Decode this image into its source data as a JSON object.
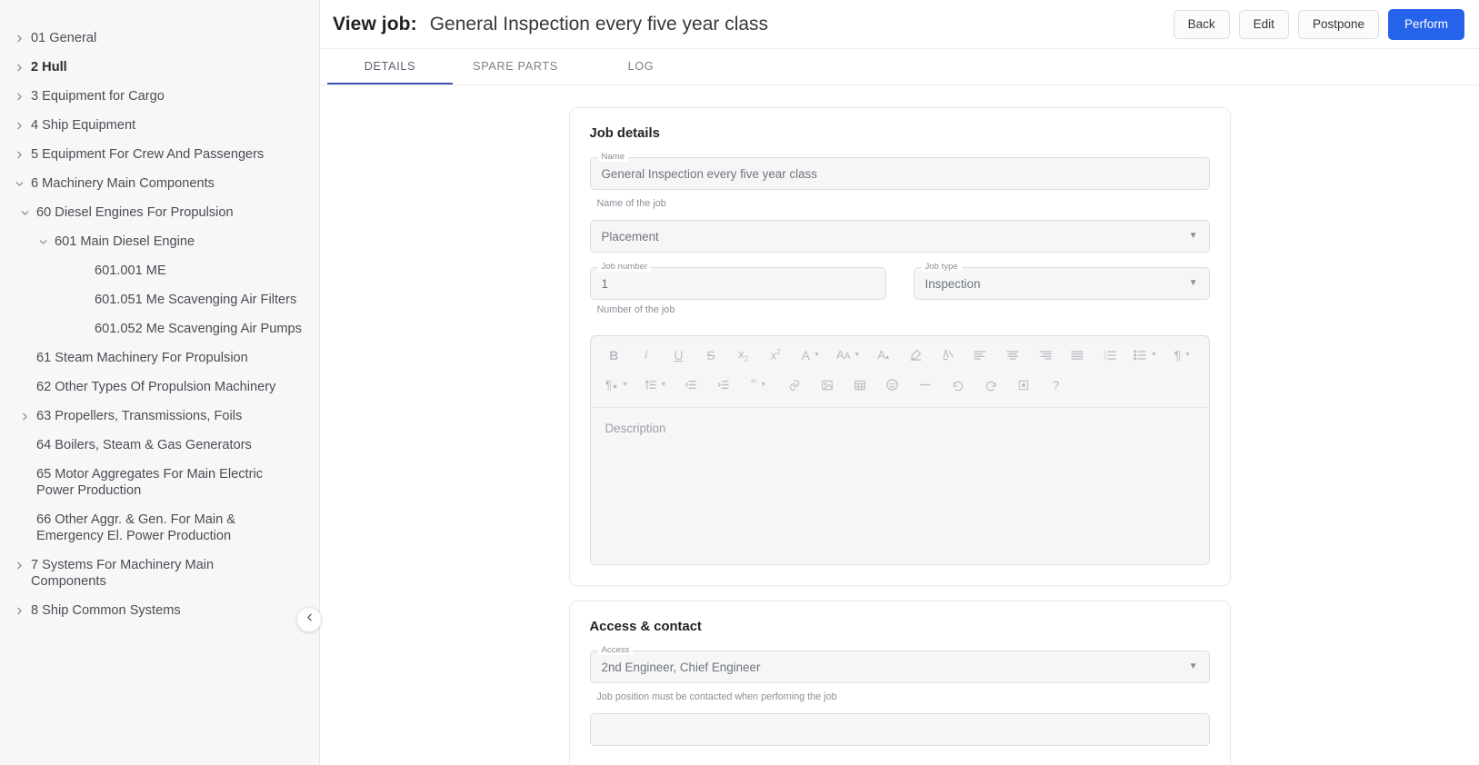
{
  "sidebar": {
    "items": [
      {
        "label": "01 General",
        "level": 1,
        "twisty": "chevron-right-icon",
        "bold": false
      },
      {
        "label": "2 Hull",
        "level": 1,
        "twisty": "chevron-right-icon",
        "bold": true
      },
      {
        "label": "3 Equipment for Cargo",
        "level": 1,
        "twisty": "chevron-right-icon",
        "bold": false
      },
      {
        "label": "4 Ship Equipment",
        "level": 1,
        "twisty": "chevron-right-icon",
        "bold": false
      },
      {
        "label": "5 Equipment For Crew And Passengers",
        "level": 1,
        "twisty": "chevron-right-icon",
        "bold": false
      },
      {
        "label": "6 Machinery Main Components",
        "level": 1,
        "twisty": "chevron-down-icon",
        "bold": false
      },
      {
        "label": "60 Diesel Engines For Propulsion",
        "level": 2,
        "twisty": "chevron-down-icon",
        "bold": false
      },
      {
        "label": "601 Main Diesel Engine",
        "level": 3,
        "twisty": "chevron-down-icon",
        "bold": false
      },
      {
        "label": "601.001 ME",
        "level": 4,
        "twisty": "none",
        "bold": false
      },
      {
        "label": "601.051 Me Scavenging Air Filters",
        "level": 4,
        "twisty": "none",
        "bold": false
      },
      {
        "label": "601.052 Me Scavenging Air Pumps",
        "level": 4,
        "twisty": "none",
        "bold": false
      },
      {
        "label": "61 Steam Machinery For Propulsion",
        "level": 2,
        "twisty": "none",
        "bold": false
      },
      {
        "label": "62 Other Types Of Propulsion Machinery",
        "level": 2,
        "twisty": "none",
        "bold": false
      },
      {
        "label": "63 Propellers, Transmissions, Foils",
        "level": 2,
        "twisty": "chevron-right-icon",
        "bold": false
      },
      {
        "label": "64 Boilers, Steam & Gas Generators",
        "level": 2,
        "twisty": "none",
        "bold": false
      },
      {
        "label": "65 Motor Aggregates For Main Electric Power Production",
        "level": 2,
        "twisty": "none",
        "bold": false
      },
      {
        "label": "66 Other Aggr. & Gen. For Main & Emergency El. Power Production",
        "level": 2,
        "twisty": "none",
        "bold": false
      },
      {
        "label": "7 Systems For Machinery Main Components",
        "level": 1,
        "twisty": "chevron-right-icon",
        "bold": false
      },
      {
        "label": "8 Ship Common Systems",
        "level": 1,
        "twisty": "chevron-right-icon",
        "bold": false
      }
    ],
    "collapse_icon": "chevron-left-icon"
  },
  "header": {
    "view_label": "View job:",
    "job_title": "General Inspection every five year class",
    "buttons": [
      {
        "label": "Back",
        "style": "secondary"
      },
      {
        "label": "Edit",
        "style": "secondary"
      },
      {
        "label": "Postpone",
        "style": "secondary"
      },
      {
        "label": "Perform",
        "style": "primary"
      }
    ],
    "primary_color": "#2563eb"
  },
  "tabs": {
    "active_index": 0,
    "active_underline_color": "#3f51b5",
    "items": [
      {
        "label": "DETAILS"
      },
      {
        "label": "SPARE PARTS"
      },
      {
        "label": "LOG"
      }
    ]
  },
  "job_details": {
    "title": "Job details",
    "name": {
      "legend": "Name",
      "value": "General Inspection every five year class",
      "helper": "Name of the job"
    },
    "placement": {
      "legend": "",
      "value": "Placement",
      "helper": ""
    },
    "job_number": {
      "legend": "Job number",
      "value": "1",
      "helper": "Number of the job"
    },
    "job_type": {
      "legend": "Job type",
      "value": "Inspection",
      "helper": ""
    },
    "description": {
      "placeholder": "Description"
    }
  },
  "editor_toolbar": {
    "row1": [
      {
        "icon": "bold-icon",
        "glyph": "B",
        "caret": false
      },
      {
        "icon": "italic-icon",
        "glyph": "i",
        "caret": false
      },
      {
        "icon": "underline-icon",
        "glyph": "U",
        "caret": false
      },
      {
        "icon": "strikethrough-icon",
        "glyph": "S",
        "caret": false
      },
      {
        "icon": "subscript-icon",
        "glyph": "x₂",
        "caret": false
      },
      {
        "icon": "superscript-icon",
        "glyph": "x²",
        "caret": false
      },
      {
        "icon": "font-family-icon",
        "glyph": "A",
        "caret": true
      },
      {
        "icon": "font-size-icon",
        "glyph": "AA",
        "caret": true
      },
      {
        "icon": "text-color-icon",
        "glyph": "A",
        "caret": false
      },
      {
        "icon": "highlight-color-icon",
        "glyph": "pen",
        "caret": false
      },
      {
        "icon": "remove-format-icon",
        "glyph": "A",
        "caret": false
      },
      {
        "icon": "align-left-icon",
        "glyph": "lines",
        "caret": false
      },
      {
        "icon": "align-center-icon",
        "glyph": "lines",
        "caret": false
      },
      {
        "icon": "align-right-icon",
        "glyph": "lines",
        "caret": false
      },
      {
        "icon": "align-justify-icon",
        "glyph": "lines",
        "caret": false
      },
      {
        "icon": "ordered-list-icon",
        "glyph": "123",
        "caret": false
      },
      {
        "icon": "bullet-list-icon",
        "glyph": "dots",
        "caret": true
      },
      {
        "icon": "paragraph-mark-icon",
        "glyph": "¶",
        "caret": true
      }
    ],
    "row2": [
      {
        "icon": "paragraph-style-icon",
        "glyph": "¶★",
        "caret": true
      },
      {
        "icon": "line-height-icon",
        "glyph": "lineheight",
        "caret": true
      },
      {
        "icon": "outdent-icon",
        "glyph": "outdent",
        "caret": false
      },
      {
        "icon": "indent-icon",
        "glyph": "indent",
        "caret": false
      },
      {
        "icon": "blockquote-icon",
        "glyph": "“",
        "caret": true
      },
      {
        "icon": "link-icon",
        "glyph": "link",
        "caret": false
      },
      {
        "icon": "image-icon",
        "glyph": "image",
        "caret": false
      },
      {
        "icon": "table-icon",
        "glyph": "table",
        "caret": false
      },
      {
        "icon": "emoji-icon",
        "glyph": "☺",
        "caret": false
      },
      {
        "icon": "horizontal-rule-icon",
        "glyph": "—",
        "caret": false
      },
      {
        "icon": "undo-icon",
        "glyph": "undo",
        "caret": false
      },
      {
        "icon": "redo-icon",
        "glyph": "redo",
        "caret": false
      },
      {
        "icon": "show-blocks-icon",
        "glyph": "blocks",
        "caret": false
      },
      {
        "icon": "help-icon",
        "glyph": "?",
        "caret": false
      }
    ]
  },
  "access_contact": {
    "title": "Access & contact",
    "access": {
      "legend": "Access",
      "value": "2nd Engineer, Chief Engineer",
      "helper": "Job position must be contacted when perfoming the job"
    }
  }
}
